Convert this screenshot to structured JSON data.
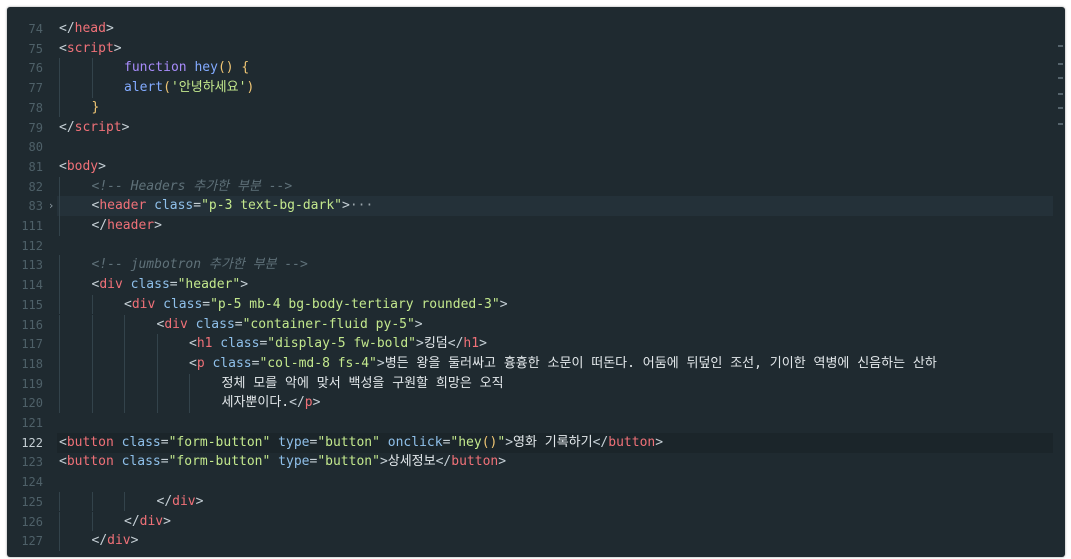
{
  "editor": {
    "lines": [
      {
        "num": "74",
        "indent": 0,
        "tokens": [
          [
            "punct",
            "</"
          ],
          [
            "tagname",
            "head"
          ],
          [
            "punct",
            ">"
          ]
        ]
      },
      {
        "num": "75",
        "indent": 0,
        "tokens": [
          [
            "punct",
            "<"
          ],
          [
            "tagname",
            "script"
          ],
          [
            "punct",
            ">"
          ]
        ]
      },
      {
        "num": "76",
        "indent": 2,
        "tokens": [
          [
            "kw",
            "function "
          ],
          [
            "fn",
            "hey"
          ],
          [
            "paren",
            "() {"
          ]
        ]
      },
      {
        "num": "77",
        "indent": 2,
        "tokens": [
          [
            "fn",
            "alert"
          ],
          [
            "paren",
            "("
          ],
          [
            "str",
            "'안녕하세요'"
          ],
          [
            "paren",
            ")"
          ]
        ]
      },
      {
        "num": "78",
        "indent": 1,
        "tokens": [
          [
            "paren",
            "}"
          ]
        ]
      },
      {
        "num": "79",
        "indent": 0,
        "tokens": [
          [
            "punct",
            "</"
          ],
          [
            "tagname",
            "script"
          ],
          [
            "punct",
            ">"
          ]
        ]
      },
      {
        "num": "80",
        "indent": 0,
        "tokens": []
      },
      {
        "num": "81",
        "indent": 0,
        "tokens": [
          [
            "punct",
            "<"
          ],
          [
            "tagname",
            "body"
          ],
          [
            "punct",
            ">"
          ]
        ]
      },
      {
        "num": "82",
        "indent": 1,
        "tokens": [
          [
            "cmt",
            "<!-- Headers 추가한 부분 -->"
          ]
        ]
      },
      {
        "num": "83",
        "indent": 1,
        "folded": true,
        "tokens": [
          [
            "punct",
            "<"
          ],
          [
            "tagname",
            "header"
          ],
          [
            "attr",
            " class"
          ],
          [
            "punct",
            "="
          ],
          [
            "str",
            "\"p-3 text-bg-dark\""
          ],
          [
            "punct",
            ">"
          ],
          [
            "dots",
            "···"
          ]
        ]
      },
      {
        "num": "111",
        "indent": 1,
        "tokens": [
          [
            "punct",
            "</"
          ],
          [
            "tagname",
            "header"
          ],
          [
            "punct",
            ">"
          ]
        ]
      },
      {
        "num": "112",
        "indent": 0,
        "tokens": []
      },
      {
        "num": "113",
        "indent": 1,
        "tokens": [
          [
            "cmt",
            "<!-- jumbotron 추가한 부분 -->"
          ]
        ]
      },
      {
        "num": "114",
        "indent": 1,
        "tokens": [
          [
            "punct",
            "<"
          ],
          [
            "tagname",
            "div"
          ],
          [
            "attr",
            " class"
          ],
          [
            "punct",
            "="
          ],
          [
            "str",
            "\"header\""
          ],
          [
            "punct",
            ">"
          ]
        ]
      },
      {
        "num": "115",
        "indent": 2,
        "tokens": [
          [
            "punct",
            "<"
          ],
          [
            "tagname",
            "div"
          ],
          [
            "attr",
            " class"
          ],
          [
            "punct",
            "="
          ],
          [
            "str",
            "\"p-5 mb-4 bg-body-tertiary rounded-3\""
          ],
          [
            "punct",
            ">"
          ]
        ]
      },
      {
        "num": "116",
        "indent": 3,
        "tokens": [
          [
            "punct",
            "<"
          ],
          [
            "tagname",
            "div"
          ],
          [
            "attr",
            " class"
          ],
          [
            "punct",
            "="
          ],
          [
            "str",
            "\"container-fluid py-5\""
          ],
          [
            "punct",
            ">"
          ]
        ]
      },
      {
        "num": "117",
        "indent": 4,
        "tokens": [
          [
            "punct",
            "<"
          ],
          [
            "tagname",
            "h1"
          ],
          [
            "attr",
            " class"
          ],
          [
            "punct",
            "="
          ],
          [
            "str",
            "\"display-5 fw-bold\""
          ],
          [
            "punct",
            ">"
          ],
          [
            "text",
            "킹덤"
          ],
          [
            "punct",
            "</"
          ],
          [
            "tagname",
            "h1"
          ],
          [
            "punct",
            ">"
          ]
        ]
      },
      {
        "num": "118",
        "indent": 4,
        "tokens": [
          [
            "punct",
            "<"
          ],
          [
            "tagname",
            "p"
          ],
          [
            "attr",
            " class"
          ],
          [
            "punct",
            "="
          ],
          [
            "str",
            "\"col-md-8 fs-4\""
          ],
          [
            "punct",
            ">"
          ],
          [
            "text",
            "병든 왕을 둘러싸고 흉흉한 소문이 떠돈다. 어둠에 뒤덮인 조선, 기이한 역병에 신음하는 산하"
          ]
        ]
      },
      {
        "num": "119",
        "indent": 5,
        "tokens": [
          [
            "text",
            "정체 모를 악에 맞서 백성을 구원할 희망은 오직"
          ]
        ]
      },
      {
        "num": "120",
        "indent": 5,
        "tokens": [
          [
            "text",
            "세자뿐이다."
          ],
          [
            "punct",
            "</"
          ],
          [
            "tagname",
            "p"
          ],
          [
            "punct",
            ">"
          ]
        ]
      },
      {
        "num": "121",
        "indent": 0,
        "tokens": []
      },
      {
        "num": "122",
        "indent": 0,
        "active": true,
        "tokens": [
          [
            "punct",
            "<"
          ],
          [
            "tagname",
            "button"
          ],
          [
            "attr",
            " class"
          ],
          [
            "punct",
            "="
          ],
          [
            "str",
            "\"form-button\""
          ],
          [
            "attr",
            " type"
          ],
          [
            "punct",
            "="
          ],
          [
            "str",
            "\"button\""
          ],
          [
            "attr",
            " onclick"
          ],
          [
            "punct",
            "="
          ],
          [
            "str",
            "\"hey"
          ],
          [
            "paren",
            "()"
          ],
          [
            "str",
            "\""
          ],
          [
            "punct",
            ">"
          ],
          [
            "text",
            "영화 기록하기"
          ],
          [
            "punct",
            "</"
          ],
          [
            "tagname",
            "button"
          ],
          [
            "punct",
            ">"
          ]
        ]
      },
      {
        "num": "123",
        "indent": 0,
        "tokens": [
          [
            "punct",
            "<"
          ],
          [
            "tagname",
            "button"
          ],
          [
            "attr",
            " class"
          ],
          [
            "punct",
            "="
          ],
          [
            "str",
            "\"form-button\""
          ],
          [
            "attr",
            " type"
          ],
          [
            "punct",
            "="
          ],
          [
            "str",
            "\"button\""
          ],
          [
            "punct",
            ">"
          ],
          [
            "text",
            "상세정보"
          ],
          [
            "punct",
            "</"
          ],
          [
            "tagname",
            "button"
          ],
          [
            "punct",
            ">"
          ]
        ]
      },
      {
        "num": "124",
        "indent": 0,
        "tokens": []
      },
      {
        "num": "125",
        "indent": 3,
        "tokens": [
          [
            "punct",
            "</"
          ],
          [
            "tagname",
            "div"
          ],
          [
            "punct",
            ">"
          ]
        ]
      },
      {
        "num": "126",
        "indent": 2,
        "tokens": [
          [
            "punct",
            "</"
          ],
          [
            "tagname",
            "div"
          ],
          [
            "punct",
            ">"
          ]
        ]
      },
      {
        "num": "127",
        "indent": 1,
        "tokens": [
          [
            "punct",
            "</"
          ],
          [
            "tagname",
            "div"
          ],
          [
            "punct",
            ">"
          ]
        ]
      }
    ],
    "fold_marker": "›",
    "colors": {
      "background": "#1f2a30",
      "tag": "#f07178",
      "attribute": "#8fc0ea",
      "string": "#c3e88d",
      "keyword": "#a78bfa",
      "function": "#82aaff",
      "comment": "#5f7179"
    }
  }
}
